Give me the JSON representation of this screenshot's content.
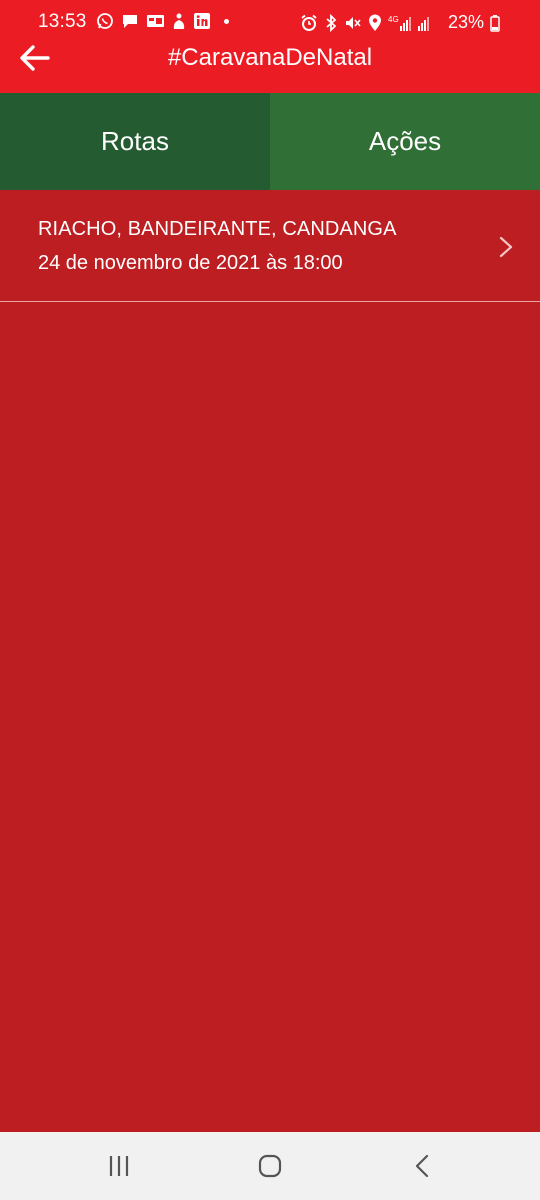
{
  "status_bar": {
    "time": "13:53",
    "network": "4G",
    "battery": "23%",
    "left_icons": [
      "whatsapp-icon",
      "message-icon",
      "notification-icon",
      "app-icon",
      "linkedin-icon"
    ],
    "right_icons": [
      "alarm-icon",
      "bluetooth-icon",
      "mute-icon",
      "location-icon",
      "signal-icon",
      "battery-icon"
    ]
  },
  "app_bar": {
    "title": "#CaravanaDeNatal",
    "back_icon": "arrow-left-icon"
  },
  "tabs": [
    {
      "label": "Rotas",
      "active": true
    },
    {
      "label": "Ações",
      "active": false
    }
  ],
  "routes": [
    {
      "title": "RIACHO, BANDEIRANTE, CANDANGA",
      "date": "24 de novembro de 2021 às 18:00",
      "icon": "chevron-right-icon"
    }
  ],
  "colors": {
    "app_bar": "#eb1c24",
    "background": "#bd1e22",
    "tab_active": "#255b31",
    "tab_inactive": "#306f35",
    "nav_bar": "#f1f1f1"
  },
  "nav_bar": {
    "icons": [
      "recent-apps-icon",
      "home-icon",
      "back-icon"
    ]
  }
}
